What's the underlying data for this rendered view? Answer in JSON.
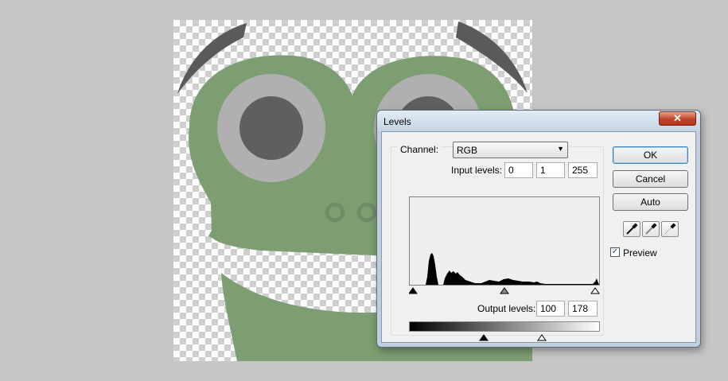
{
  "dialog": {
    "title": "Levels",
    "close_glyph": "✕",
    "channel_label": "Channel:",
    "channel_value": "RGB",
    "input_levels_label": "Input levels:",
    "input_levels": [
      "0",
      "1",
      "255"
    ],
    "output_levels_label": "Output levels:",
    "output_levels": [
      "100",
      "178"
    ],
    "buttons": {
      "ok": "OK",
      "cancel": "Cancel",
      "auto": "Auto"
    },
    "preview_label": "Preview",
    "preview_checked": true,
    "eyedroppers": [
      "black-point-eyedropper-icon",
      "gray-point-eyedropper-icon",
      "white-point-eyedropper-icon"
    ]
  },
  "colors": {
    "frog_green": "#7d9e72",
    "eye_white": "#b0b0b0",
    "pupil": "#5f5f5f",
    "brow": "#5c5c5c",
    "dialog_frame": "#bfcfe0",
    "close_red": "#c0432a"
  }
}
